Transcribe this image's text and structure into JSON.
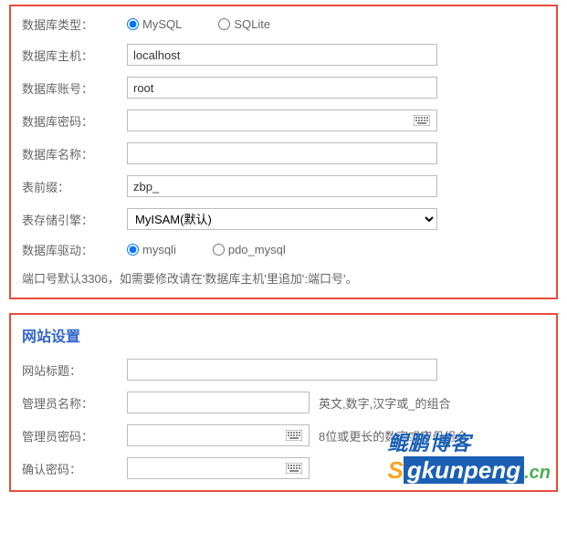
{
  "db": {
    "labels": {
      "type": "数据库类型：",
      "host": "数据库主机：",
      "user": "数据库账号：",
      "password": "数据库密码：",
      "name": "数据库名称：",
      "prefix": "表前缀：",
      "engine": "表存储引擎：",
      "driver": "数据库驱动："
    },
    "type_options": {
      "mysql": "MySQL",
      "sqlite": "SQLite"
    },
    "host_value": "localhost",
    "user_value": "root",
    "password_value": "",
    "name_value": "",
    "prefix_value": "zbp_",
    "engine_value": "MyISAM(默认)",
    "driver_options": {
      "mysqli": "mysqli",
      "pdo": "pdo_mysql"
    },
    "note": "端口号默认3306，如需要修改请在'数据库主机'里追加':端口号'。"
  },
  "site": {
    "title": "网站设置",
    "labels": {
      "site_title": "网站标题：",
      "admin_name": "管理员名称：",
      "admin_password": "管理员密码：",
      "confirm_password": "确认密码："
    },
    "site_title_value": "",
    "admin_name_value": "",
    "admin_password_value": "",
    "confirm_password_value": "",
    "hints": {
      "admin_name": "英文,数字,汉字或_的组合",
      "admin_password": "8位或更长的数字或字母组合"
    }
  },
  "watermark": {
    "top": "鲲鹏博客",
    "s": "S",
    "g": "gkunpeng",
    "cn": ".cn"
  }
}
